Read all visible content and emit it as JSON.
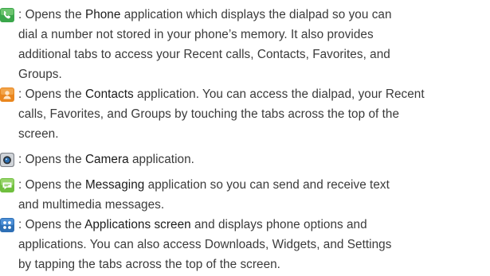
{
  "entries": [
    {
      "icon": "phone-icon",
      "lines": [
        [
          ": Opens the ",
          {
            "b": "Phone"
          },
          " application which displays the dialpad so you can"
        ],
        [
          "dial a number not stored in your phone’s memory. It also provides"
        ],
        [
          "additional tabs to access your Recent calls, Contacts, Favorites, and"
        ],
        [
          "Groups."
        ]
      ]
    },
    {
      "icon": "contacts-icon",
      "lines": [
        [
          ": Opens the ",
          {
            "b": "Contacts"
          },
          " application. You can access the dialpad, your Recent"
        ],
        [
          "calls, Favorites, and Groups by touching the tabs across the top of the"
        ],
        [
          "screen."
        ]
      ]
    },
    {
      "icon": "camera-icon",
      "lines": [
        [
          ": Opens the ",
          {
            "b": "Camera"
          },
          " application."
        ]
      ]
    },
    {
      "icon": "messaging-icon",
      "lines": [
        [
          ": Opens the ",
          {
            "b": "Messaging"
          },
          " application so you can send and receive text"
        ],
        [
          "and multimedia messages."
        ]
      ]
    },
    {
      "icon": "applications-icon",
      "lines": [
        [
          ": Opens the ",
          {
            "b": "Applications screen"
          },
          " and displays phone options and"
        ],
        [
          "applications. You can also access Downloads, Widgets, and Settings"
        ],
        [
          "by tapping the tabs across the top of the screen."
        ]
      ]
    }
  ]
}
